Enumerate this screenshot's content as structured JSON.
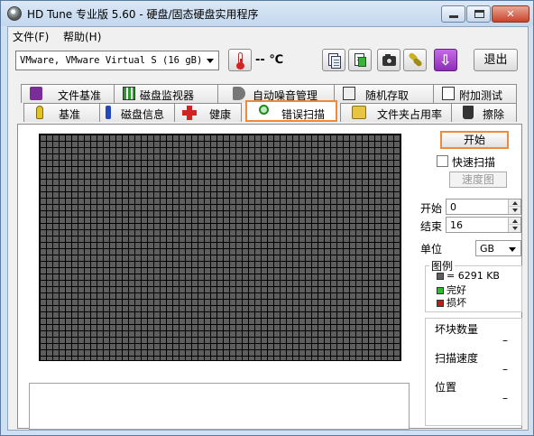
{
  "window": {
    "title": "HD Tune 专业版 5.60 - 硬盘/固态硬盘实用程序",
    "close_glyph": "✕"
  },
  "menu": {
    "file": "文件(F)",
    "help": "帮助(H)"
  },
  "toolbar": {
    "drive": "VMware, VMware Virtual S (16 gB)",
    "temperature": "-- ℃",
    "exit_label": "退出",
    "icons": [
      "thermometer-icon",
      "copy-text-icon",
      "copy-screenshot-icon",
      "camera-icon",
      "options-icon",
      "save-download-icon"
    ]
  },
  "tabs": {
    "row1": [
      "文件基准",
      "磁盘监视器",
      "自动噪音管理",
      "随机存取",
      "附加测试"
    ],
    "row2": [
      "基准",
      "磁盘信息",
      "健康",
      "错误扫描",
      "文件夹占用率",
      "擦除"
    ],
    "active": "错误扫描"
  },
  "scan": {
    "start_label": "开始",
    "quick_scan_label": "快速扫描",
    "quick_scan_checked": false,
    "speed_map_label": "速度图",
    "start_label_field": "开始",
    "start_value": "0",
    "end_label": "结束",
    "end_value": "16",
    "unit_label": "单位",
    "unit_value": "GB",
    "legend_title": "图例",
    "legend_block": "= 6291 KB",
    "legend_ok": "完好",
    "legend_bad": "损坏",
    "bad_blocks_label": "坏块数量",
    "bad_blocks_value": "–",
    "scan_speed_label": "扫描速度",
    "scan_speed_value": "–",
    "position_label": "位置",
    "position_value": "–"
  },
  "colors": {
    "block_gray": "#5e5e5e",
    "ok_green": "#22c322",
    "bad_red": "#c41a1a",
    "highlight_orange": "#f08a3b"
  }
}
